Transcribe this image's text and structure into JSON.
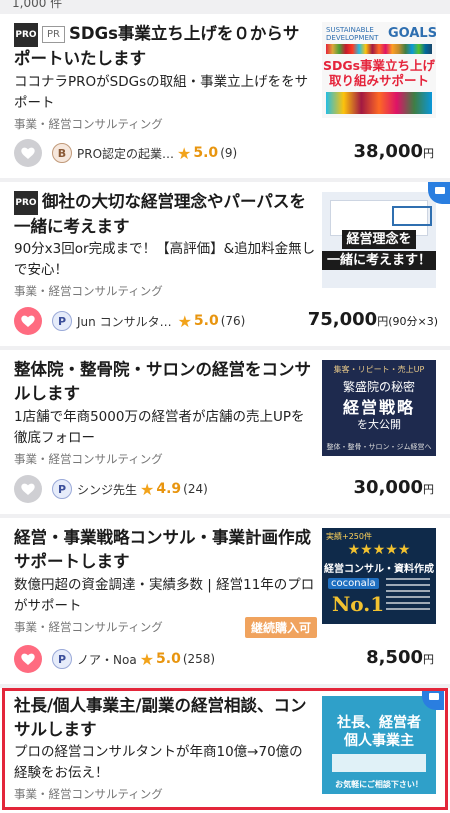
{
  "top_strip_text": "1,000 件",
  "cards": [
    {
      "tags": {
        "pro": "PRO",
        "pr": "PR"
      },
      "title": "SDGs事業立ち上げを０からサポートいたします",
      "desc": "ココナラPROがSDGsの取組・事業立上げををサポート",
      "category": "事業・経営コンサルティング",
      "seller": "PRO認定の起業…",
      "seller_badge": "B",
      "rating": "5.0",
      "reviews": "(9)",
      "price": "38,000",
      "price_unit": "円",
      "thumb": {
        "top": "SUSTAINABLE DEVELOPMENT",
        "goals": "GOALS",
        "line1": "SDGs事業立ち上げ",
        "line2": "取り組みサポート"
      }
    },
    {
      "tags": {
        "pro": "PRO"
      },
      "title": "御社の大切な経営理念やパーパスを一緒に考えます",
      "desc": "90分x3回or完成まで！【高評価】&追加料金無しで安心！",
      "category": "事業・経営コンサルティング",
      "seller": "Jun コンサルタ…",
      "seller_badge": "P",
      "rating": "5.0",
      "reviews": "(76)",
      "price": "75,000",
      "price_unit": "円",
      "price_suffix": "(90分×3)",
      "thumb": {
        "line1": "経営理念を",
        "line2": "一緒に考えます！"
      }
    },
    {
      "title": "整体院・整骨院・サロンの経営をコンサルします",
      "desc": "1店舗で年商5000万の経営者が店舗の売上UPを徹底フォロー",
      "category": "事業・経営コンサルティング",
      "seller": "シンジ先生",
      "seller_badge": "P",
      "rating": "4.9",
      "reviews": "(24)",
      "price": "30,000",
      "price_unit": "円",
      "thumb": {
        "top": "集客・リピート・売上UP",
        "line1": "繁盛院の秘密",
        "line2": "経営戦略",
        "line3": "を大公開",
        "bottom": "整体・整骨・サロン・ジム経営へ"
      }
    },
    {
      "title": "経営・事業戦略コンサル・事業計画作成サポートします",
      "desc": "数億円超の資金調達・実績多数 | 経営11年のプロがサポート",
      "category": "事業・経営コンサルティング",
      "badge": "継続購入可",
      "seller": "ノア・Noa",
      "seller_badge": "P",
      "rating": "5.0",
      "reviews": "(258)",
      "price": "8,500",
      "price_unit": "円",
      "thumb": {
        "top": "実績+250件",
        "line1": "経営コンサル・資料作成",
        "brand": "coconala",
        "line2": "No.1"
      }
    },
    {
      "title": "社長/個人事業主/副業の経営相談、コンサルします",
      "desc": "プロの経営コンサルタントが年商10億→70億の経験をお伝え！",
      "category": "事業・経営コンサルティング",
      "thumb": {
        "line1": "社長、経営者",
        "line2": "個人事業主",
        "bottom": "お気軽にご相談下さい！"
      }
    }
  ],
  "colors": {
    "accent_orange": "#e8950f",
    "fav_active": "#ff6b80",
    "highlight": "#e3263a",
    "video_badge": "#2a7ee0"
  }
}
